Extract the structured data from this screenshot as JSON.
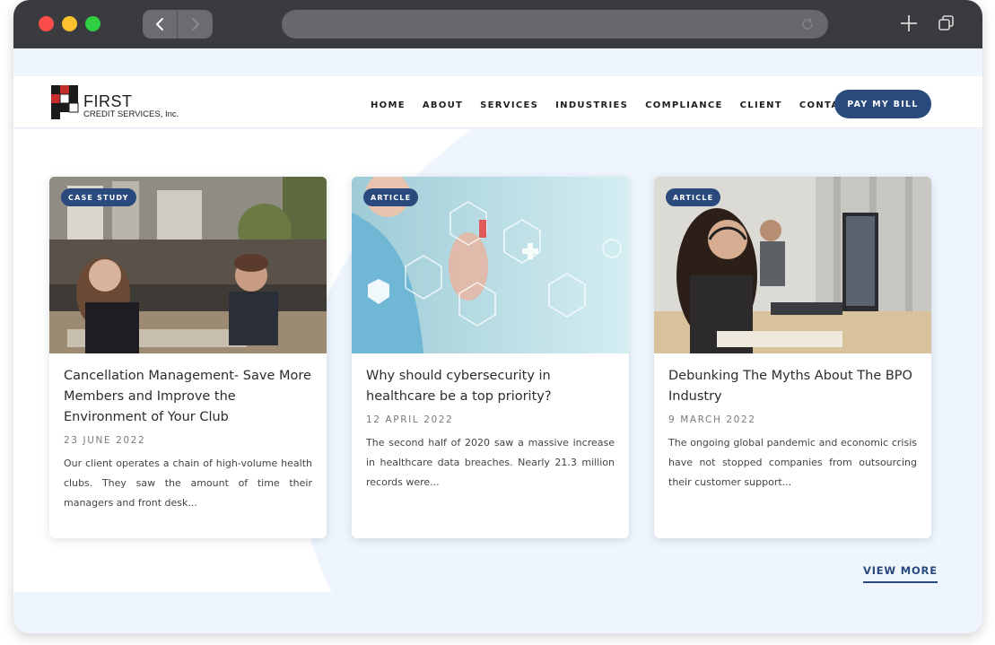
{
  "browser": {
    "back_icon": "chevron-left-icon",
    "forward_icon": "chevron-right-icon",
    "reload_icon": "reload-icon",
    "new_tab_icon": "plus-icon",
    "tabs_icon": "tabs-icon"
  },
  "header": {
    "logo_text": "FIRST",
    "logo_subtext": "CREDIT SERVICES, Inc.",
    "nav": [
      "HOME",
      "ABOUT",
      "SERVICES",
      "INDUSTRIES",
      "COMPLIANCE",
      "CLIENT",
      "CONTACT"
    ],
    "cta": "PAY MY BILL"
  },
  "cards": [
    {
      "badge": "CASE STUDY",
      "title": "Cancellation Management- Save More Members and Improve the Environment of Your Club",
      "date": "23 JUNE 2022",
      "excerpt": "Our client operates a chain of high-volume health clubs. They saw the amount of time their managers and front desk..."
    },
    {
      "badge": "ARTICLE",
      "title": "Why should cybersecurity in healthcare be a top priority?",
      "date": "12 APRIL 2022",
      "excerpt": "The second half of 2020 saw a massive increase in healthcare data breaches. Nearly 21.3 million records were..."
    },
    {
      "badge": "ARTICLE",
      "title": "Debunking The Myths About The BPO Industry",
      "date": "9 MARCH 2022",
      "excerpt": "The ongoing global pandemic and economic crisis have not stopped companies from outsourcing their customer support..."
    }
  ],
  "view_more": "VIEW MORE",
  "colors": {
    "brand": "#2a4a7d",
    "page_bg": "#eef5fd",
    "chrome": "#3a3b3f"
  }
}
